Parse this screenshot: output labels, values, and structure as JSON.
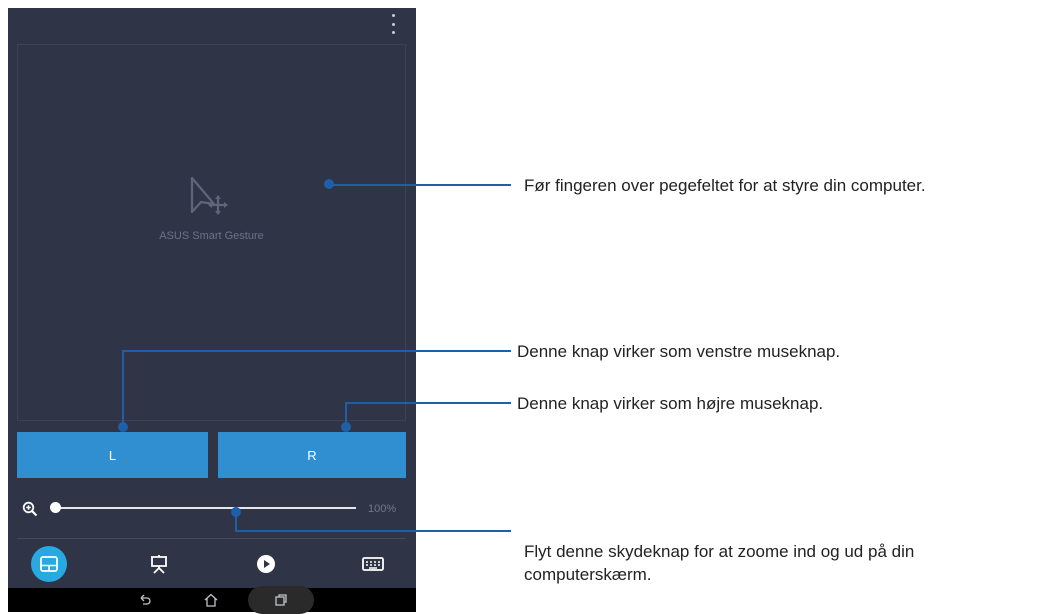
{
  "app": {
    "pad_label": "ASUS Smart Gesture",
    "left_button_label": "L",
    "right_button_label": "R",
    "zoom_percent": "100%",
    "zoom_level": 0.0,
    "menu_icon": "overflow-menu-icon",
    "tabs": [
      {
        "icon": "touchpad-icon",
        "active": true
      },
      {
        "icon": "presentation-icon",
        "active": false
      },
      {
        "icon": "media-play-icon",
        "active": false
      },
      {
        "icon": "keyboard-icon",
        "active": false
      }
    ],
    "nav": [
      "back-icon",
      "home-icon",
      "recent-apps-icon"
    ]
  },
  "annotations": {
    "touchpad": "Før fingeren over pegefeltet for at styre din computer.",
    "left_button": "Denne knap virker som venstre museknap.",
    "right_button": "Denne knap virker som højre museknap.",
    "zoom_line1": "Flyt denne skydeknap for at zoome ind og ud på din",
    "zoom_line2": "computerskærm."
  },
  "colors": {
    "app_background": "#2f3547",
    "button_blue": "#2f8fd0",
    "active_tab": "#27a9e1",
    "callout_line": "#1e5fa8"
  }
}
